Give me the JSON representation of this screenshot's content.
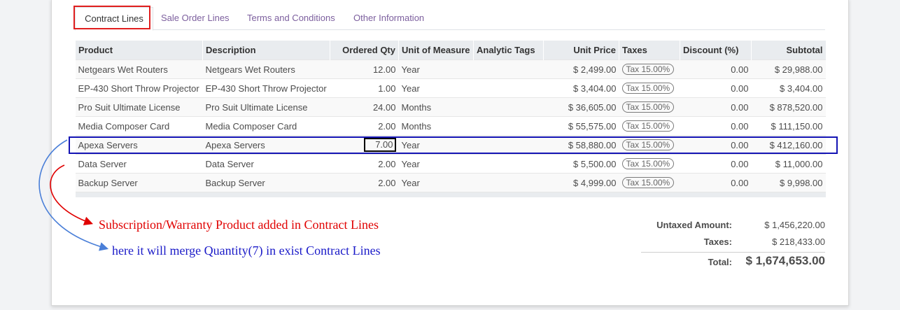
{
  "tabs": [
    {
      "label": "Contract Lines",
      "active": true
    },
    {
      "label": "Sale Order Lines",
      "active": false
    },
    {
      "label": "Terms and Conditions",
      "active": false
    },
    {
      "label": "Other Information",
      "active": false
    }
  ],
  "table": {
    "columns": [
      "Product",
      "Description",
      "Ordered Qty",
      "Unit of Measure",
      "Analytic Tags",
      "Unit Price",
      "Taxes",
      "Discount (%)",
      "Subtotal"
    ],
    "rows": [
      {
        "product": "Netgears Wet Routers",
        "description": "Netgears Wet Routers",
        "qty": "12.00",
        "uom": "Year",
        "tags": "",
        "price": "$ 2,499.00",
        "tax": "Tax 15.00%",
        "discount": "0.00",
        "subtotal": "$ 29,988.00"
      },
      {
        "product": "EP-430 Short Throw Projector",
        "description": "EP-430 Short Throw Projector",
        "qty": "1.00",
        "uom": "Year",
        "tags": "",
        "price": "$ 3,404.00",
        "tax": "Tax 15.00%",
        "discount": "0.00",
        "subtotal": "$ 3,404.00"
      },
      {
        "product": "Pro Suit Ultimate License",
        "description": "Pro Suit Ultimate License",
        "qty": "24.00",
        "uom": "Months",
        "tags": "",
        "price": "$ 36,605.00",
        "tax": "Tax 15.00%",
        "discount": "0.00",
        "subtotal": "$ 878,520.00"
      },
      {
        "product": "Media Composer Card",
        "description": "Media Composer Card",
        "qty": "2.00",
        "uom": "Months",
        "tags": "",
        "price": "$ 55,575.00",
        "tax": "Tax 15.00%",
        "discount": "0.00",
        "subtotal": "$ 111,150.00"
      },
      {
        "product": "Apexa Servers",
        "description": "Apexa Servers",
        "qty": "7.00",
        "uom": "Year",
        "tags": "",
        "price": "$ 58,880.00",
        "tax": "Tax 15.00%",
        "discount": "0.00",
        "subtotal": "$ 412,160.00"
      },
      {
        "product": "Data Server",
        "description": "Data Server",
        "qty": "2.00",
        "uom": "Year",
        "tags": "",
        "price": "$ 5,500.00",
        "tax": "Tax 15.00%",
        "discount": "0.00",
        "subtotal": "$ 11,000.00"
      },
      {
        "product": "Backup Server",
        "description": "Backup Server",
        "qty": "2.00",
        "uom": "Year",
        "tags": "",
        "price": "$ 4,999.00",
        "tax": "Tax 15.00%",
        "discount": "0.00",
        "subtotal": "$ 9,998.00"
      }
    ]
  },
  "annotations": {
    "red_note": "Subscription/Warranty Product added in Contract Lines",
    "blue_note": "here it will merge Quantity(7)  in exist Contract Lines",
    "red_color": "#e00000",
    "blue_color": "#1a1ac8"
  },
  "totals": {
    "untaxed_label": "Untaxed Amount:",
    "untaxed_value": "$ 1,456,220.00",
    "taxes_label": "Taxes:",
    "taxes_value": "$ 218,433.00",
    "total_label": "Total:",
    "total_value": "$ 1,674,653.00"
  },
  "colors": {
    "tab_link": "#7c5f9e",
    "header_bg": "#e9ecef"
  }
}
